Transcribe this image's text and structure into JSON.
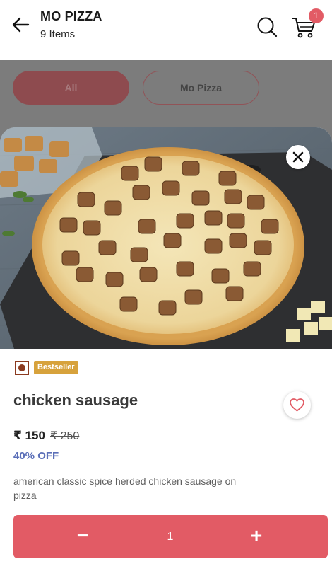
{
  "header": {
    "title": "MO PIZZA",
    "subtitle": "9 Items",
    "cart_count": "1"
  },
  "filters": {
    "chips": [
      {
        "label": "All",
        "selected": true
      },
      {
        "label": "Mo Pizza",
        "selected": false
      }
    ]
  },
  "product": {
    "badge": "Bestseller",
    "name": "chicken sausage",
    "price": "₹ 150",
    "original_price": "₹ 250",
    "discount": "40% OFF",
    "description": "american classic spice herded chicken sausage on pizza",
    "veg_indicator": "non-veg"
  },
  "quantity": {
    "minus_label": "−",
    "value": "1",
    "plus_label": "+"
  },
  "colors": {
    "accent": "#e25b65",
    "discount": "#5b6fb8",
    "bestseller": "#d7a23c"
  }
}
